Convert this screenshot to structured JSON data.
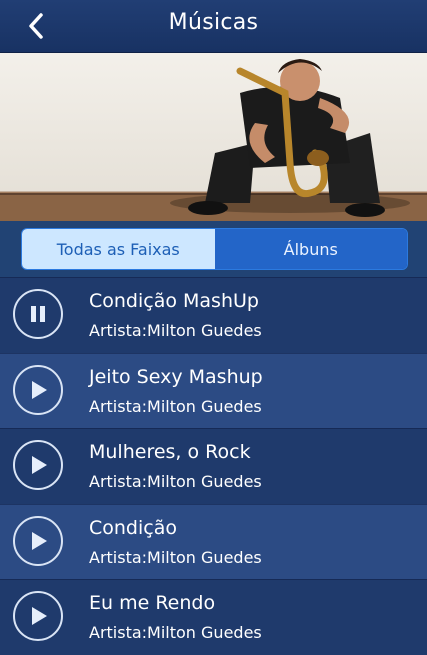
{
  "header": {
    "title": "Músicas",
    "back_icon": "chevron-left-icon"
  },
  "tabs": [
    {
      "label": "Todas as Faixas",
      "active": true
    },
    {
      "label": "Álbuns",
      "active": false
    }
  ],
  "tracks": [
    {
      "title": "Condição MashUp",
      "artist": "Artista:Milton Guedes",
      "state": "playing",
      "icon": "pause-icon"
    },
    {
      "title": "Jeito Sexy Mashup",
      "artist": "Artista:Milton Guedes",
      "state": "stopped",
      "icon": "play-icon"
    },
    {
      "title": "Mulheres, o Rock",
      "artist": "Artista:Milton Guedes",
      "state": "stopped",
      "icon": "play-icon"
    },
    {
      "title": "Condição",
      "artist": "Artista:Milton Guedes",
      "state": "stopped",
      "icon": "play-icon"
    },
    {
      "title": "Eu me Rendo",
      "artist": "Artista:Milton Guedes",
      "state": "stopped",
      "icon": "play-icon"
    }
  ],
  "colors": {
    "header_bg": "#1a3566",
    "active_tab_bg": "#cde7ff",
    "inactive_tab_bg": "#2365c8"
  }
}
